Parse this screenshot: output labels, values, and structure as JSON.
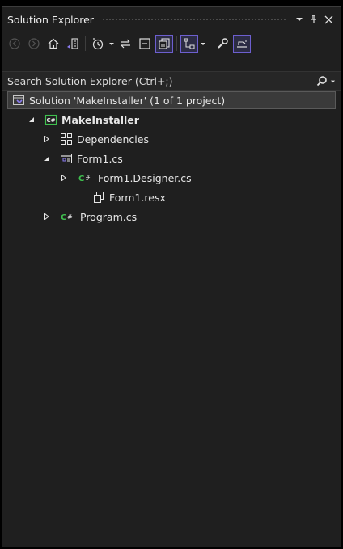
{
  "panel": {
    "title": "Solution Explorer",
    "pin_icon": "pin-icon",
    "close_icon": "close-icon",
    "menu_icon": "dropdown-arrow-icon"
  },
  "toolbar": {
    "icons": [
      "back-icon",
      "forward-icon",
      "home-icon",
      "switch-views-icon",
      "pending-changes-filter-icon",
      "sync-icon",
      "collapse-all-icon",
      "show-all-files-icon",
      "preview-selected-icon",
      "properties-icon",
      "track-active-item-icon"
    ]
  },
  "search": {
    "placeholder": "Search Solution Explorer (Ctrl+;)"
  },
  "tree": {
    "solution_label": "Solution 'MakeInstaller' (1 of 1 project)",
    "project_label": "MakeInstaller",
    "items": [
      {
        "label": "Dependencies"
      },
      {
        "label": "Form1.cs"
      },
      {
        "label": "Form1.Designer.cs"
      },
      {
        "label": "Form1.resx"
      },
      {
        "label": "Program.cs"
      }
    ]
  },
  "colors": {
    "background": "#1f1f1f",
    "accent": "#6d5fcf",
    "csharp_green": "#3fbf4f",
    "selection": "#3a3a3a"
  }
}
